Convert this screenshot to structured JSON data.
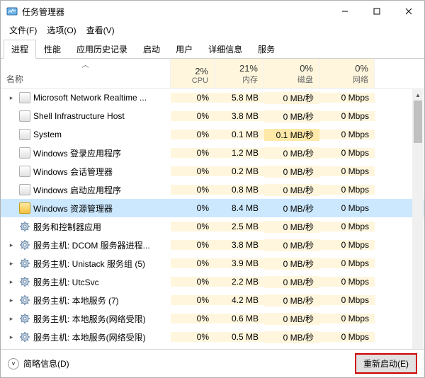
{
  "window": {
    "title": "任务管理器"
  },
  "menubar": {
    "file": "文件(F)",
    "options": "选项(O)",
    "view": "查看(V)"
  },
  "tabs": [
    {
      "label": "进程",
      "active": true
    },
    {
      "label": "性能",
      "active": false
    },
    {
      "label": "应用历史记录",
      "active": false
    },
    {
      "label": "启动",
      "active": false
    },
    {
      "label": "用户",
      "active": false
    },
    {
      "label": "详细信息",
      "active": false
    },
    {
      "label": "服务",
      "active": false
    }
  ],
  "columns": {
    "name": "名称",
    "cpu": {
      "pct": "2%",
      "label": "CPU"
    },
    "mem": {
      "pct": "21%",
      "label": "内存"
    },
    "disk": {
      "pct": "0%",
      "label": "磁盘"
    },
    "net": {
      "pct": "0%",
      "label": "网络"
    }
  },
  "rows": [
    {
      "exp": "▸",
      "icon": "generic",
      "name": "Microsoft Network Realtime ...",
      "cpu": "0%",
      "mem": "5.8 MB",
      "disk": "0 MB/秒",
      "net": "0 Mbps"
    },
    {
      "exp": "",
      "icon": "generic",
      "name": "Shell Infrastructure Host",
      "cpu": "0%",
      "mem": "3.8 MB",
      "disk": "0 MB/秒",
      "net": "0 Mbps"
    },
    {
      "exp": "",
      "icon": "generic",
      "name": "System",
      "cpu": "0%",
      "mem": "0.1 MB",
      "disk": "0.1 MB/秒",
      "diskHi": true,
      "net": "0 Mbps"
    },
    {
      "exp": "",
      "icon": "generic",
      "name": "Windows 登录应用程序",
      "cpu": "0%",
      "mem": "1.2 MB",
      "disk": "0 MB/秒",
      "net": "0 Mbps"
    },
    {
      "exp": "",
      "icon": "generic",
      "name": "Windows 会话管理器",
      "cpu": "0%",
      "mem": "0.2 MB",
      "disk": "0 MB/秒",
      "net": "0 Mbps"
    },
    {
      "exp": "",
      "icon": "generic",
      "name": "Windows 启动应用程序",
      "cpu": "0%",
      "mem": "0.8 MB",
      "disk": "0 MB/秒",
      "net": "0 Mbps"
    },
    {
      "exp": "",
      "icon": "folder",
      "name": "Windows 资源管理器",
      "cpu": "0%",
      "mem": "8.4 MB",
      "disk": "0 MB/秒",
      "net": "0 Mbps",
      "selected": true
    },
    {
      "exp": "",
      "icon": "gear",
      "name": "服务和控制器应用",
      "cpu": "0%",
      "mem": "2.5 MB",
      "disk": "0 MB/秒",
      "net": "0 Mbps"
    },
    {
      "exp": "▸",
      "icon": "gear",
      "name": "服务主机: DCOM 服务器进程...",
      "cpu": "0%",
      "mem": "3.8 MB",
      "disk": "0 MB/秒",
      "net": "0 Mbps"
    },
    {
      "exp": "▸",
      "icon": "gear",
      "name": "服务主机: Unistack 服务组 (5)",
      "cpu": "0%",
      "mem": "3.9 MB",
      "disk": "0 MB/秒",
      "net": "0 Mbps"
    },
    {
      "exp": "▸",
      "icon": "gear",
      "name": "服务主机: UtcSvc",
      "cpu": "0%",
      "mem": "2.2 MB",
      "disk": "0 MB/秒",
      "net": "0 Mbps"
    },
    {
      "exp": "▸",
      "icon": "gear",
      "name": "服务主机: 本地服务 (7)",
      "cpu": "0%",
      "mem": "4.2 MB",
      "disk": "0 MB/秒",
      "net": "0 Mbps"
    },
    {
      "exp": "▸",
      "icon": "gear",
      "name": "服务主机: 本地服务(网络受限)",
      "cpu": "0%",
      "mem": "0.6 MB",
      "disk": "0 MB/秒",
      "net": "0 Mbps"
    },
    {
      "exp": "▸",
      "icon": "gear",
      "name": "服务主机: 本地服务(网络受限)",
      "cpu": "0%",
      "mem": "0.5 MB",
      "disk": "0 MB/秒",
      "net": "0 Mbps"
    }
  ],
  "footer": {
    "brief": "简略信息(D)",
    "restart": "重新启动(E)"
  }
}
